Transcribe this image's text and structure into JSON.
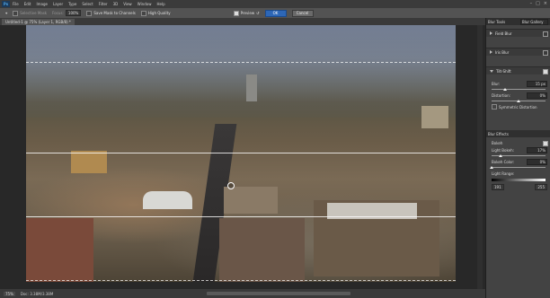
{
  "app": {
    "logo": "Ps"
  },
  "menubar": {
    "items": [
      "File",
      "Edit",
      "Image",
      "Layer",
      "Type",
      "Select",
      "Filter",
      "3D",
      "View",
      "Window",
      "Help"
    ]
  },
  "options": {
    "selective_label": "Selective Mask",
    "focus_label": "Focus:",
    "focus_value": "100%",
    "save_mask_label": "Save Mask to Channels",
    "high_quality_label": "High Quality",
    "preview_label": "Preview",
    "ok_label": "OK",
    "cancel_label": "Cancel"
  },
  "document": {
    "tab_title": "Untitled-1 @ 75% (Layer 1, RGB/8) *"
  },
  "status": {
    "zoom": "75%",
    "doc_info": "Doc: 3.38M/3.38M"
  },
  "panel": {
    "title": "Blur Tools",
    "dropdown": "Blur Gallery",
    "sections": [
      {
        "label": "Field Blur",
        "expanded": false
      },
      {
        "label": "Iris Blur",
        "expanded": false
      },
      {
        "label": "Tilt-Shift",
        "expanded": true
      }
    ],
    "tilt_shift": {
      "blur_label": "Blur:",
      "blur_value": "15 px",
      "blur_fraction": 0.25,
      "distortion_label": "Distortion:",
      "distortion_value": "0%",
      "distortion_fraction": 0.5,
      "symmetric_label": "Symmetric Distortion"
    },
    "effects_title": "Blur Effects",
    "effects": {
      "bokeh_label": "Bokeh",
      "light_bokeh_label": "Light Bokeh:",
      "light_bokeh_value": "17%",
      "light_bokeh_fraction": 0.17,
      "bokeh_color_label": "Bokeh Color:",
      "bokeh_color_value": "0%",
      "bokeh_color_fraction": 0.0,
      "light_range_label": "Light Range:",
      "light_range_low": "191",
      "light_range_high": "255"
    }
  }
}
